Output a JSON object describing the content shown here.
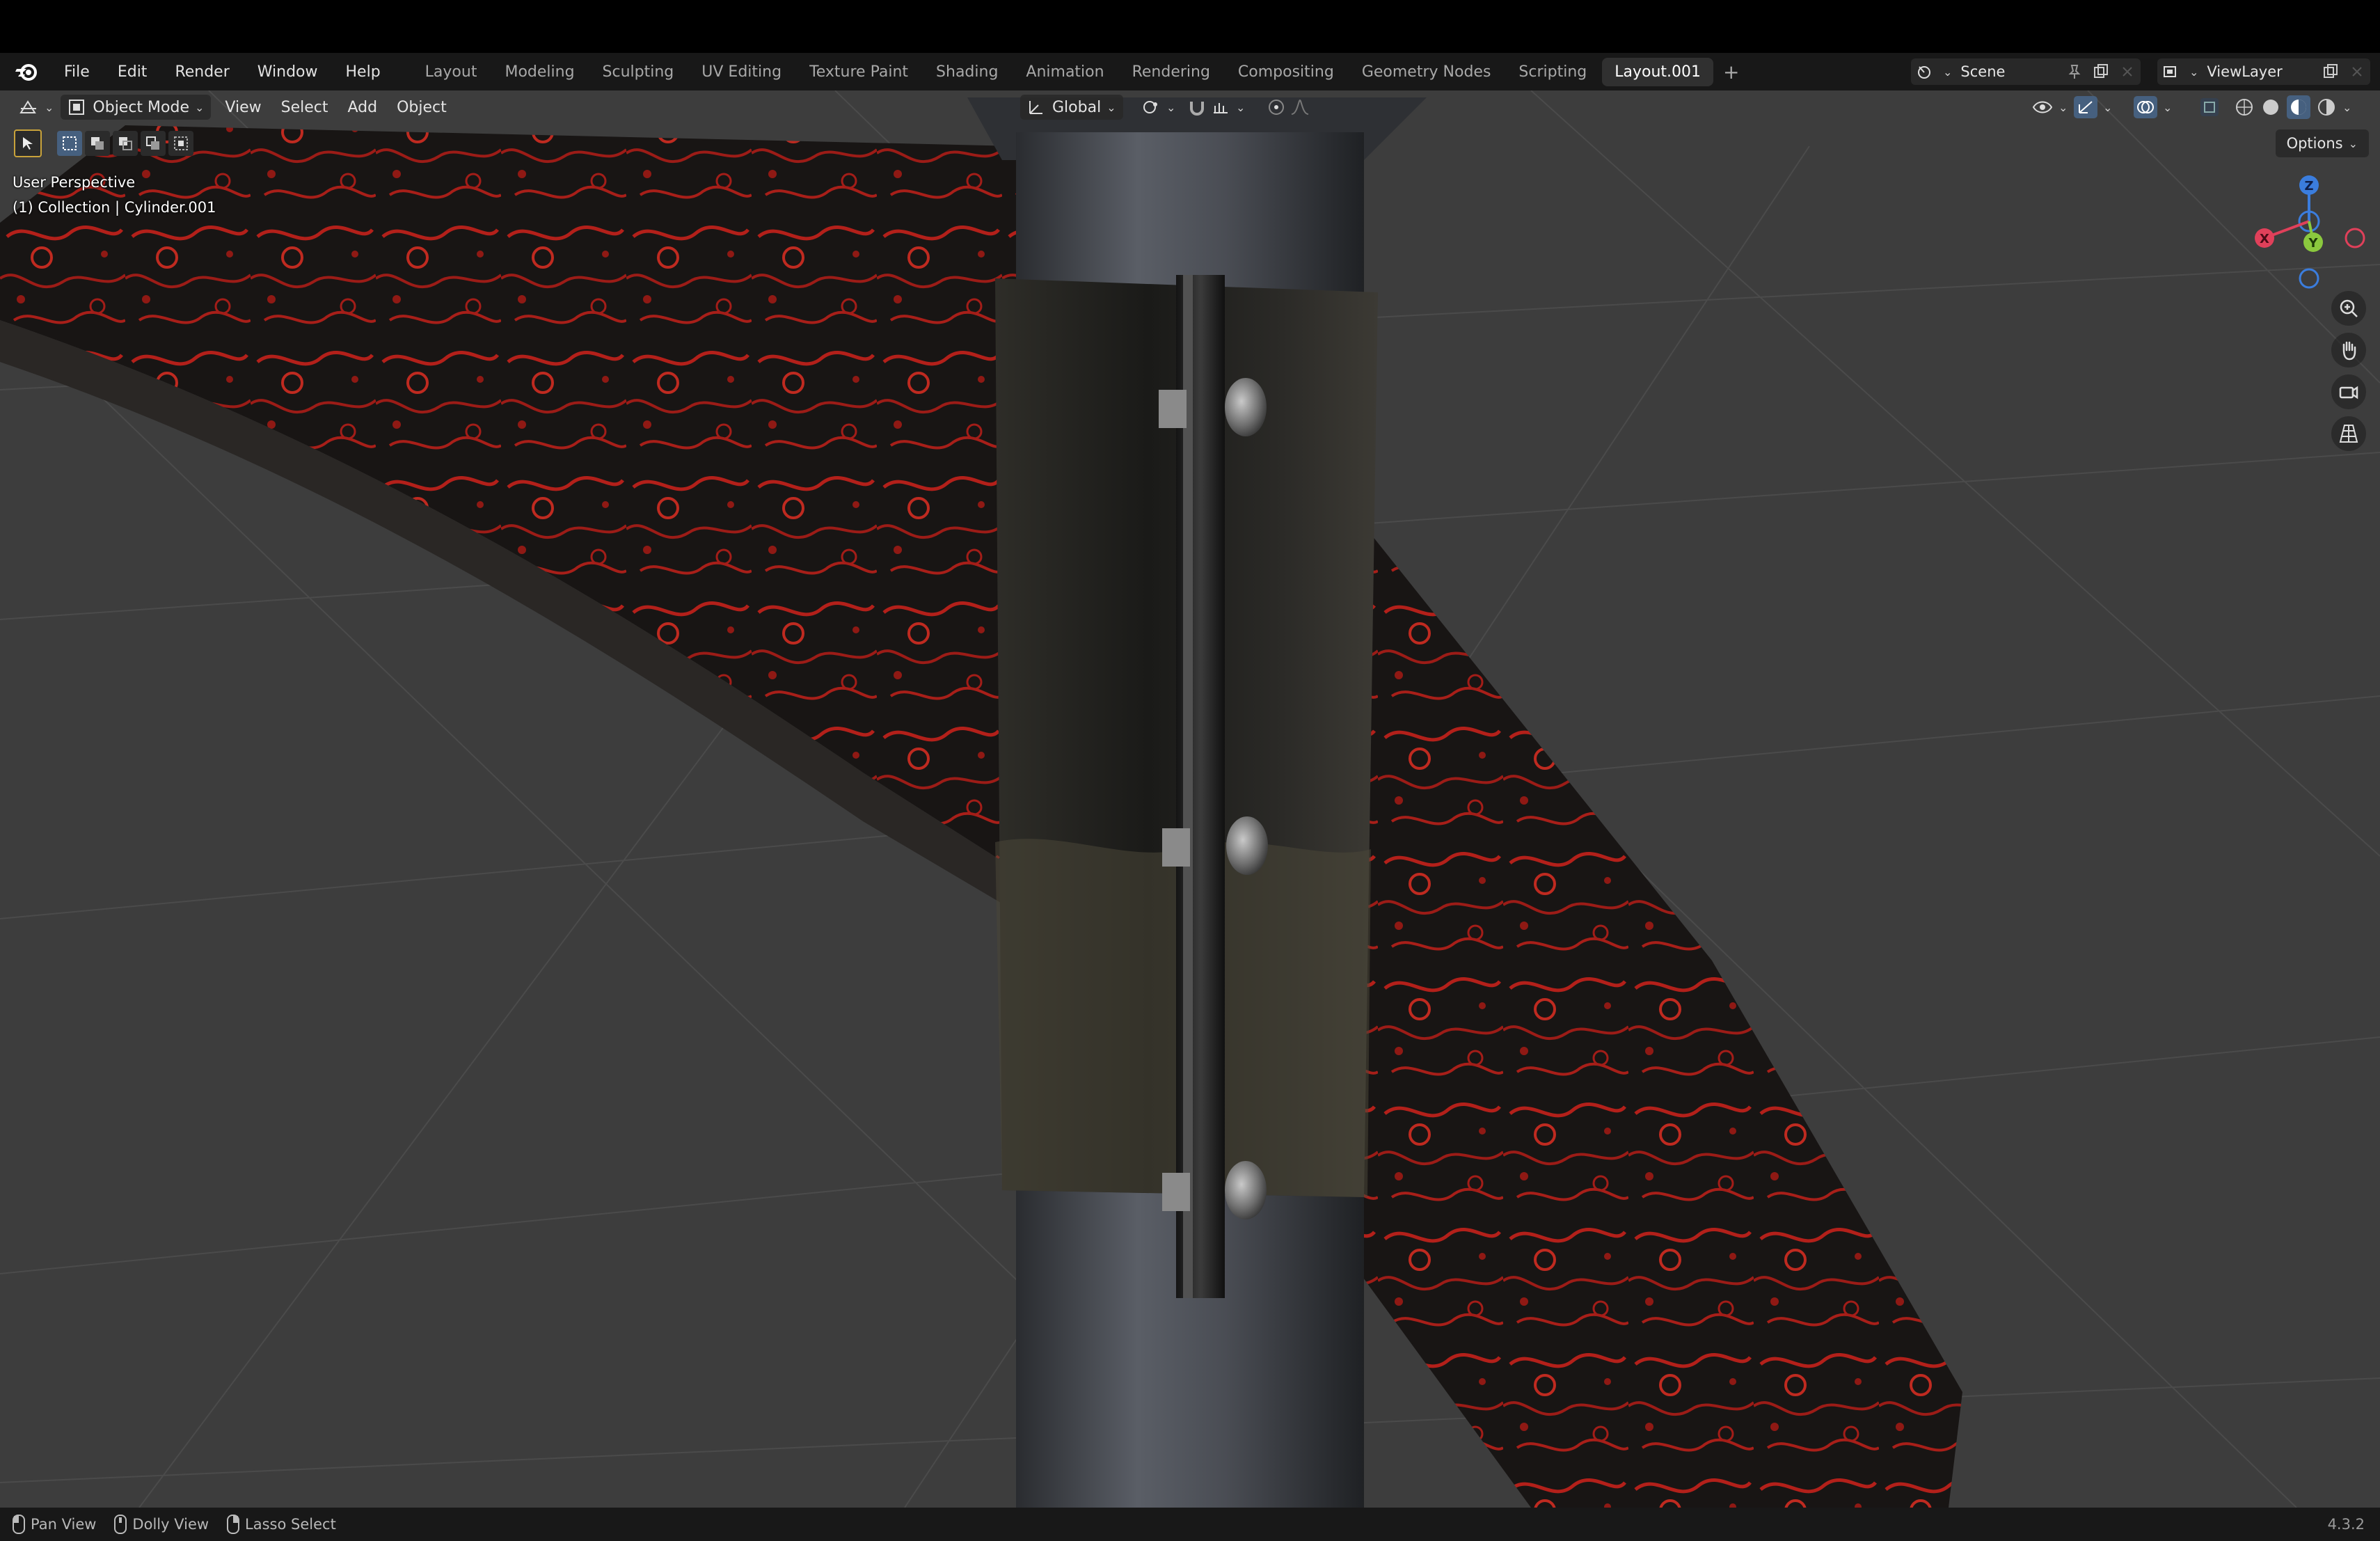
{
  "menu": {
    "items": [
      "File",
      "Edit",
      "Render",
      "Window",
      "Help"
    ]
  },
  "workspaces": {
    "tabs": [
      "Layout",
      "Modeling",
      "Sculpting",
      "UV Editing",
      "Texture Paint",
      "Shading",
      "Animation",
      "Rendering",
      "Compositing",
      "Geometry Nodes",
      "Scripting",
      "Layout.001"
    ],
    "active": "Layout.001",
    "add_symbol": "+"
  },
  "scene": {
    "name": "Scene"
  },
  "view_layer": {
    "name": "ViewLayer"
  },
  "viewport_header": {
    "mode": "Object Mode",
    "menus": [
      "View",
      "Select",
      "Add",
      "Object"
    ],
    "transform_orientation": "Global"
  },
  "viewport": {
    "perspective_label": "User Perspective",
    "collection_label": "(1) Collection | Cylinder.001",
    "options_label": "Options"
  },
  "gizmo": {
    "axes": [
      {
        "label": "Z",
        "color": "#3b7ddd"
      },
      {
        "label": "Y",
        "color": "#8bc93e"
      },
      {
        "label": "X",
        "color": "#e0405a"
      }
    ]
  },
  "nav_icons": [
    "zoom-icon",
    "hand-pan-icon",
    "camera-view-icon",
    "grid-ortho-icon"
  ],
  "status": {
    "items": [
      "Pan View",
      "Dolly View",
      "Lasso Select"
    ],
    "version": "4.3.2"
  },
  "colors": {
    "viewport_bg": "#3d3d3d",
    "header_bg": "#181818",
    "active_tab": "#303030",
    "lava_red": "#c0221c"
  }
}
